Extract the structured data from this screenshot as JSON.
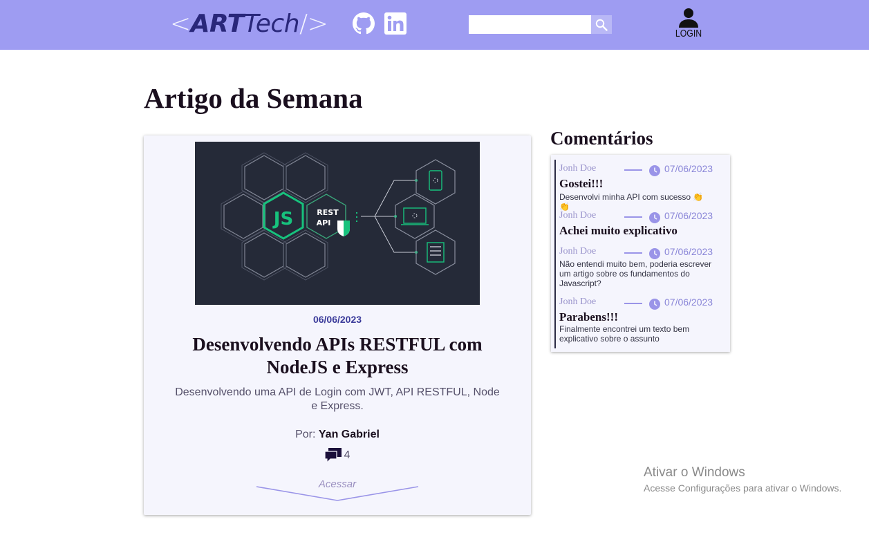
{
  "header": {
    "logo": {
      "open": "<",
      "art": "ART",
      "tech": "ech",
      "t": "T",
      "close": "/>"
    },
    "social": [
      "github-icon",
      "linkedin-icon"
    ],
    "search": {
      "value": "",
      "placeholder": ""
    },
    "login_label": "LOGIN",
    "colors": {
      "bar": "#9e9cf2",
      "logo_dark": "#29277a"
    }
  },
  "page": {
    "title": "Artigo da Semana"
  },
  "article": {
    "date": "06/06/2023",
    "title": "Desenvolvendo APIs RESTFUL com NodeJS e Express",
    "description": "Desenvolvendo uma API de Login com JWT, API RESTFUL, Node e Express.",
    "author_prefix": "Por:",
    "author": "Yan Gabriel",
    "comment_count": "4",
    "access_label": "Acessar",
    "thumbnail": {
      "api_text_1": "REST",
      "api_text_2": "API",
      "logo": "JS"
    }
  },
  "comments": {
    "title": "Comentários",
    "items": [
      {
        "user": "Jonh Doe",
        "date": "07/06/2023",
        "title": "Gostei!!!",
        "body": "Desenvolvi minha API com sucesso 👏 👏"
      },
      {
        "user": "Jonh Doe",
        "date": "07/06/2023",
        "title": "Achei muito explicativo",
        "body": ""
      },
      {
        "user": "Jonh Doe",
        "date": "07/06/2023",
        "title": "",
        "body": "Não entendi muito bem, poderia escrever um artigo sobre os fundamentos do Javascript?"
      },
      {
        "user": "Jonh Doe",
        "date": "07/06/2023",
        "title": "Parabens!!!",
        "body": "Finalmente encontrei um texto bem explicativo sobre o assunto"
      }
    ]
  },
  "watermark": {
    "line1": "Ativar o Windows",
    "line2": "Acesse Configurações para ativar o Windows."
  }
}
